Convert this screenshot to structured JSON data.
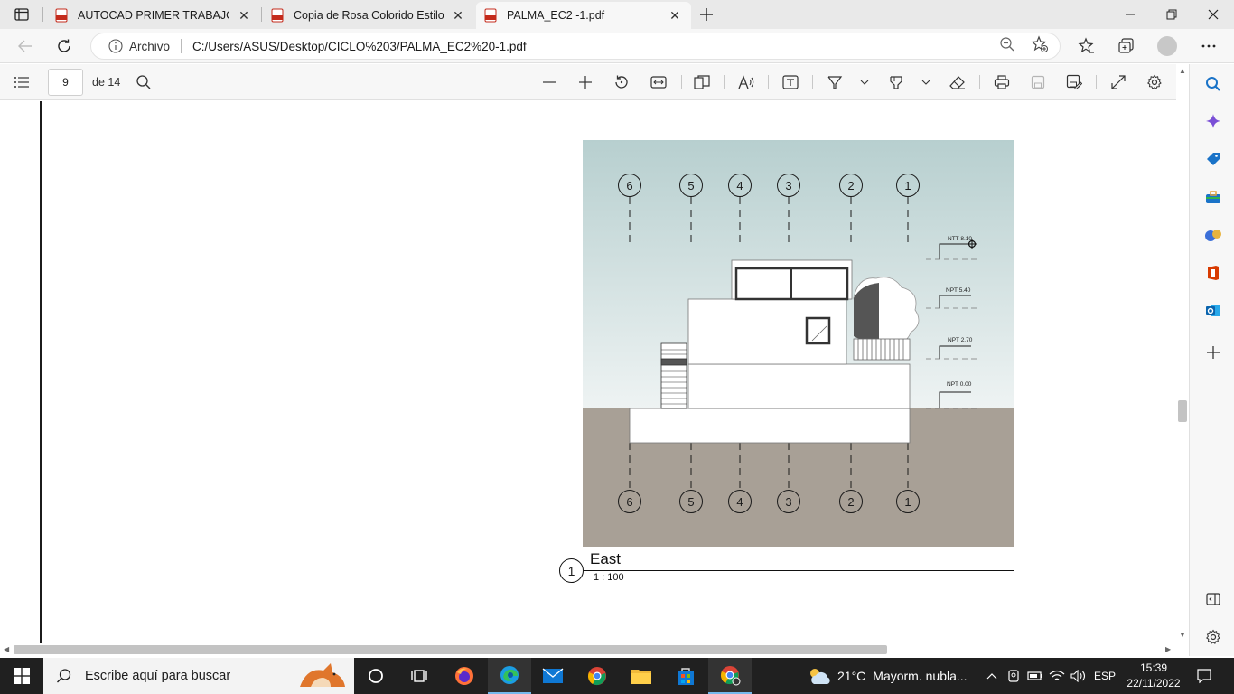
{
  "browser": {
    "tabs": [
      {
        "label": "AUTOCAD PRIMER TRABAJO.pdf",
        "active": false
      },
      {
        "label": "Copia de Rosa Colorido Estilo Se",
        "active": false
      },
      {
        "label": "PALMA_EC2 -1.pdf",
        "active": true
      }
    ],
    "site_label": "Archivo",
    "url": "C:/Users/ASUS/Desktop/CICLO%203/PALMA_EC2%20-1.pdf"
  },
  "pdf_toolbar": {
    "page_current": "9",
    "page_total": "de 14"
  },
  "drawing": {
    "grid_labels": [
      "6",
      "5",
      "4",
      "3",
      "2",
      "1"
    ],
    "levels": [
      "NTT 8.10",
      "NPT 5.40",
      "NPT 2.70",
      "NPT 0.00"
    ],
    "view_number": "1",
    "view_title": "East",
    "view_scale": "1 : 100",
    "colors": {
      "sky_top": "#b7cfcf",
      "sky_bottom": "#eef3f3",
      "ground": "#a8a096",
      "wall": "#ffffff",
      "line": "#1b1b1b"
    }
  },
  "taskbar": {
    "search_placeholder": "Escribe aquí para buscar",
    "weather_temp": "21°C",
    "weather_desc": "Mayorm. nubla...",
    "language": "ESP",
    "time": "15:39",
    "date": "22/11/2022"
  }
}
